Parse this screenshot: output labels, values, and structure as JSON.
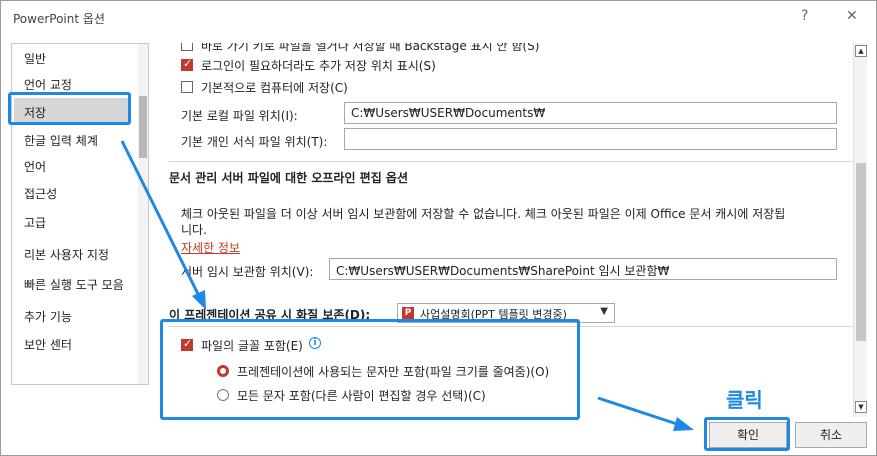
{
  "window": {
    "title": "PowerPoint 옵션",
    "help_label": "?",
    "close_label": "✕"
  },
  "sidebar": {
    "items": [
      {
        "label": "일반"
      },
      {
        "label": "언어 교정"
      },
      {
        "label": "저장"
      },
      {
        "label": "한글 입력 체계"
      },
      {
        "label": "언어"
      },
      {
        "label": "접근성"
      },
      {
        "label": "고급"
      },
      {
        "label": "리본 사용자 지정"
      },
      {
        "label": "빠른 실행 도구 모음"
      },
      {
        "label": "추가 기능"
      },
      {
        "label": "보안 센터"
      }
    ]
  },
  "save": {
    "backstage_option": "바로 가기 키로 파일을 열거나 저장할 때 Backstage 표시 안 함(S)",
    "signin_option": "로그인이 필요하더라도 추가 저장 위치 표시(S)",
    "computer_default_option": "기본적으로 컴퓨터에 저장(C)",
    "local_path_label": "기본 로컬 파일 위치(I):",
    "local_path_value": "C:₩Users₩USER₩Documents₩",
    "template_path_label": "기본 개인 서식 파일 위치(T):",
    "template_path_value": ""
  },
  "offline": {
    "title": "문서 관리 서버 파일에 대한 오프라인 편집 옵션",
    "description_line1": "체크 아웃된 파일을 더 이상 서버 임시 보관함에 저장할 수 없습니다. 체크 아웃된 파일은 이제 Office 문서 캐시에 저장됩",
    "description_line2": "니다.",
    "more_info_link": "자세한 정보",
    "server_drafts_label": "서버 임시 보관함 위치(V):",
    "server_drafts_value": "C:₩Users₩USER₩Documents₩SharePoint 임시 보관함₩"
  },
  "fidelity": {
    "label": "이 프레젠테이션 공유 시 화질 보존(D):",
    "dropdown_value": "사업설명회(PPT 템플릿 변경중)",
    "embed_fonts_label": "파일의 글꼴 포함(E)",
    "info_symbol": "i",
    "radio_subset": "프레젠테이션에 사용되는 문자만 포함(파일 크기를 줄여줌)(O)",
    "radio_all": "모든 문자 포함(다른 사람이 편집할 경우 선택)(C)"
  },
  "buttons": {
    "ok": "확인",
    "cancel": "취소"
  },
  "annotation": {
    "click_label": "클릭"
  },
  "colors": {
    "accent_red": "#c0392b",
    "highlight_blue": "#1e88e5"
  }
}
